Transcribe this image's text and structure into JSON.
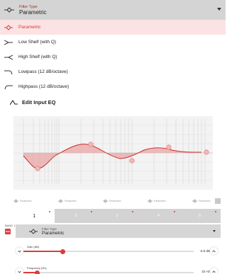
{
  "dropdown": {
    "caption": "Filter Type",
    "value": "Parametric"
  },
  "menu": {
    "items": [
      {
        "label": "Parametric",
        "selected": true,
        "icon": "parametric-icon"
      },
      {
        "label": "Low Shelf (with Q)",
        "selected": false,
        "icon": "low-shelf-icon"
      },
      {
        "label": "High Shelf (with Q)",
        "selected": false,
        "icon": "high-shelf-icon"
      },
      {
        "label": "Lowpass (12 dB/octave)",
        "selected": false,
        "icon": "lowpass-icon"
      },
      {
        "label": "Highpass (12 dB/octave)",
        "selected": false,
        "icon": "highpass-icon"
      }
    ]
  },
  "section": {
    "title": "Edit Input EQ"
  },
  "bands_legend": [
    "Parametric",
    "Parametric",
    "Parametric",
    "Parametric",
    "Parametric"
  ],
  "tabs": [
    "1",
    "2",
    "3",
    "4",
    "5"
  ],
  "band": {
    "label": "BAND 1",
    "filter_caption": "Filter Type",
    "filter_value": "Parametric"
  },
  "gain": {
    "label": "Gain (dB)",
    "value": "-6.9 dB",
    "level": 0.23
  },
  "frequency": {
    "label": "Frequency (Hz)",
    "value": "32 Hz",
    "level": 0.08
  },
  "colors": {
    "accent": "#dc3c3c",
    "selected_bg": "#fbe3e3",
    "header_bg": "#d4d4d4"
  }
}
